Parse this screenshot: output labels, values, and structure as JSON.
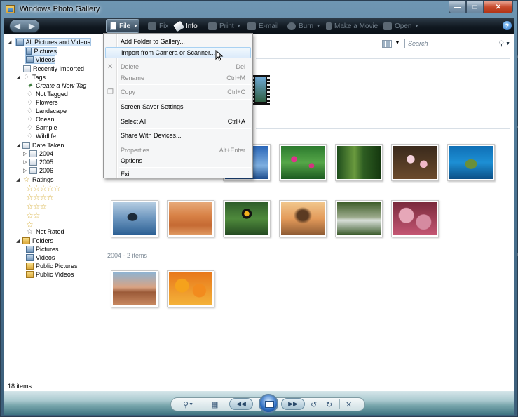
{
  "window": {
    "title": "Windows Photo Gallery"
  },
  "toolbar": {
    "file": "File",
    "fix": "Fix",
    "info": "Info",
    "print": "Print",
    "email": "E-mail",
    "burn": "Burn",
    "make_movie": "Make a Movie",
    "open": "Open",
    "help": "?"
  },
  "file_menu": {
    "items": [
      {
        "label": "Add Folder to Gallery...",
        "shortcut": ""
      },
      {
        "label": "Import from Camera or Scanner...",
        "shortcut": ""
      },
      {
        "label": "Delete",
        "shortcut": "Del"
      },
      {
        "label": "Rename",
        "shortcut": "Ctrl+M"
      },
      {
        "label": "Copy",
        "shortcut": "Ctrl+C"
      },
      {
        "label": "Screen Saver Settings",
        "shortcut": ""
      },
      {
        "label": "Select All",
        "shortcut": "Ctrl+A"
      },
      {
        "label": "Share With Devices...",
        "shortcut": ""
      },
      {
        "label": "Properties",
        "shortcut": "Alt+Enter"
      },
      {
        "label": "Options",
        "shortcut": ""
      },
      {
        "label": "Exit",
        "shortcut": ""
      }
    ]
  },
  "nav": {
    "all": "All Pictures and Videos",
    "pictures": "Pictures",
    "videos": "Videos",
    "recent": "Recently Imported",
    "tags": "Tags",
    "create_tag": "Create a New Tag",
    "not_tagged": "Not Tagged",
    "tag_flowers": "Flowers",
    "tag_landscape": "Landscape",
    "tag_ocean": "Ocean",
    "tag_sample": "Sample",
    "tag_wildlife": "Wildlife",
    "date_taken": "Date Taken",
    "y2004": "2004",
    "y2005": "2005",
    "y2006": "2006",
    "ratings": "Ratings",
    "not_rated": "Not Rated",
    "folders": "Folders",
    "f_pictures": "Pictures",
    "f_videos": "Videos",
    "f_public_pictures": "Public Pictures",
    "f_public_videos": "Public Videos"
  },
  "search": {
    "placeholder": "Search"
  },
  "groups": {
    "g2004": "2004 - 2 items"
  },
  "status": {
    "count": "18 items"
  }
}
